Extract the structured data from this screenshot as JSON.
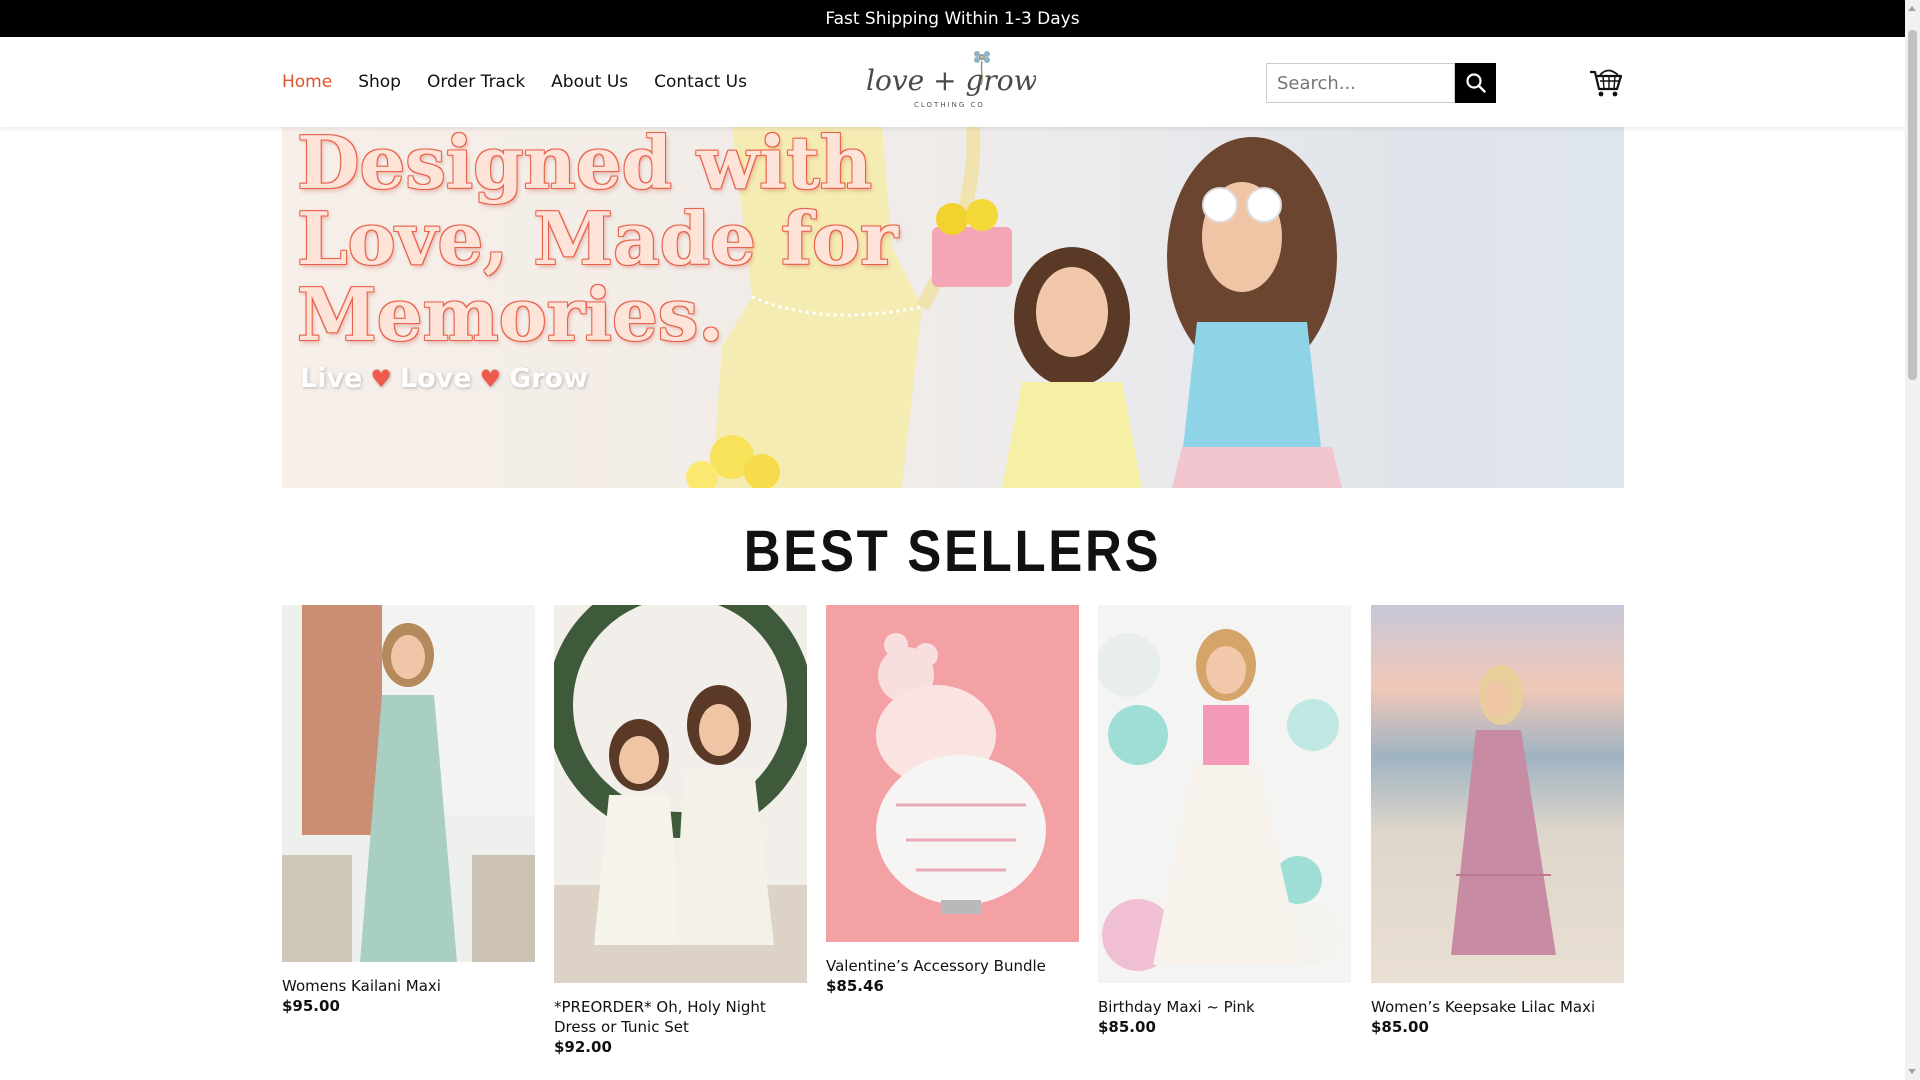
{
  "announcement": "Fast Shipping Within 1-3 Days",
  "nav": {
    "items": [
      {
        "label": "Home",
        "active": true
      },
      {
        "label": "Shop"
      },
      {
        "label": "Order Track"
      },
      {
        "label": "About Us"
      },
      {
        "label": "Contact Us"
      }
    ]
  },
  "logo": {
    "script": "love + grow",
    "subtext": "CLOTHING CO"
  },
  "search": {
    "placeholder": "Search..."
  },
  "icons": {
    "search": "search-icon",
    "cart": "cart-icon",
    "logo_flower": "flower-icon"
  },
  "hero": {
    "line1": "Designed with",
    "line2": "Love, Made for",
    "line3": "Memories.",
    "tagline": [
      "Live",
      "Love",
      "Grow"
    ]
  },
  "best_sellers": {
    "title": "BEST SELLERS",
    "products": [
      {
        "name": "Womens Kailani Maxi",
        "price": "$95.00"
      },
      {
        "name": "*PREORDER* Oh, Holy Night Dress or Tunic Set",
        "price": "$92.00"
      },
      {
        "name": "Valentine’s Accessory Bundle",
        "price": "$85.46"
      },
      {
        "name": "Birthday Maxi ~ Pink",
        "price": "$85.00"
      },
      {
        "name": "Women’s Keepsake Lilac Maxi",
        "price": "$85.00"
      }
    ]
  },
  "colors": {
    "accent": "#e0522a",
    "topbar": "#000000",
    "hero_text": "#fde3d8",
    "heart": "#ef5a4d"
  }
}
